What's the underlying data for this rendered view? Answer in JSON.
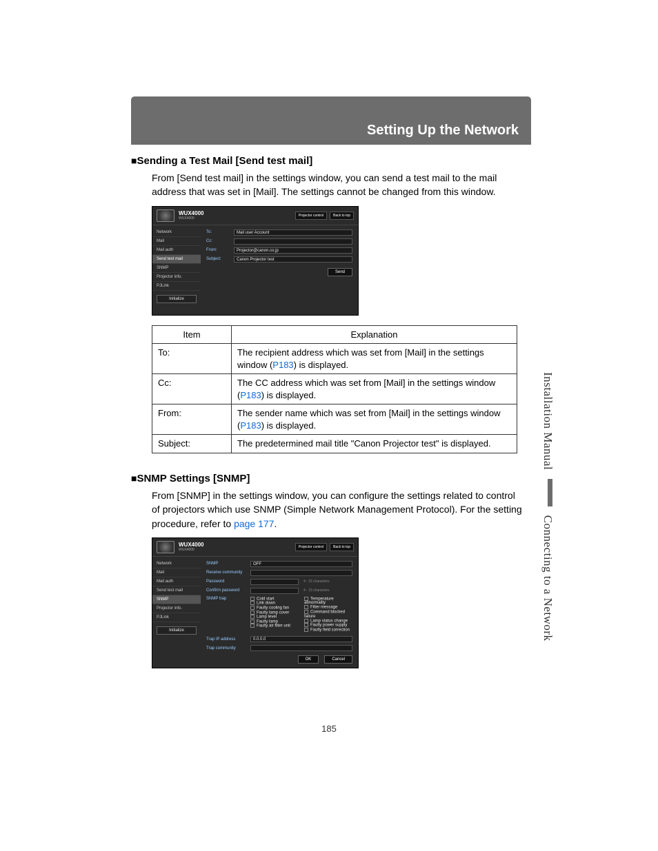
{
  "header": {
    "title": "Setting Up the Network"
  },
  "section1": {
    "heading": "Sending a Test Mail [Send test mail]",
    "para": "From [Send test mail] in the settings window, you can send a test mail to the mail address that was set in [Mail]. The settings cannot be changed from this window."
  },
  "shot1": {
    "title": "WUX4000",
    "subtitle": "WUX4000",
    "btn_control": "Projector control",
    "btn_back": "Back to top",
    "side": [
      "Network",
      "Mail",
      "Mail auth",
      "Send test mail",
      "SNMP",
      "Projector info.",
      "PJLink"
    ],
    "side_active": "Send test mail",
    "init": "Initialize",
    "rows": {
      "to_label": "To:",
      "to_val": "Mail user Account",
      "cc_label": "Cc:",
      "cc_val": "",
      "from_label": "From:",
      "from_val": "Projector@canon.co.jp",
      "subj_label": "Subject:",
      "subj_val": "Canon Projector test"
    },
    "send": "Send"
  },
  "table1": {
    "h_item": "Item",
    "h_expl": "Explanation",
    "rows": [
      {
        "item": "To:",
        "pre": "The recipient address which was set from [Mail] in the settings window (",
        "link": "P183",
        "post": ") is displayed."
      },
      {
        "item": "Cc:",
        "pre": "The CC address which was set from [Mail] in the settings window (",
        "link": "P183",
        "post": ") is displayed."
      },
      {
        "item": "From:",
        "pre": "The sender name which was set from [Mail] in the settings window (",
        "link": "P183",
        "post": ") is displayed."
      },
      {
        "item": "Subject:",
        "pre": "The predetermined mail title \"Canon Projector test\" is displayed.",
        "link": "",
        "post": ""
      }
    ]
  },
  "section2": {
    "heading": "SNMP Settings [SNMP]",
    "para_pre": "From [SNMP] in the settings window, you can configure the settings related to control of projectors which use SNMP (Simple Network Management Protocol). For the setting procedure, refer to ",
    "para_link": "page 177",
    "para_post": "."
  },
  "shot2": {
    "title": "WUX4000",
    "subtitle": "WUX4000",
    "btn_control": "Projector control",
    "btn_back": "Back to top",
    "side": [
      "Network",
      "Mail",
      "Mail auth",
      "Send test mail",
      "SNMP",
      "Projector info.",
      "PJLink"
    ],
    "side_active": "SNMP",
    "init": "Initialize",
    "fields": {
      "snmp": "SNMP",
      "snmp_val": "OFF",
      "rcomm": "Receive community",
      "pwd": "Password",
      "pwd_hint": "4 - 15 characters",
      "cpwd": "Confirm password",
      "cpwd_hint": "4 - 15 characters",
      "trap": "SNMP trap",
      "trap_ip": "Trap IP address",
      "trap_ip_val": "0.0.0.0",
      "trap_comm": "Trap community"
    },
    "checks_left": [
      "Cold start",
      "Link down",
      "Faulty cooling fan",
      "Faulty lamp cover",
      "Lamp level",
      "Faulty lamp",
      "Faulty air filter unit"
    ],
    "checks_right": [
      "Temperature abnormality",
      "Filter message",
      "Command blocked failure",
      "Lamp status change",
      "Faulty power supply",
      "Faulty field correction"
    ],
    "ok": "OK",
    "cancel": "Cancel"
  },
  "side": {
    "a": "Installation Manual",
    "b": "Connecting to a Network"
  },
  "page_number": "185"
}
